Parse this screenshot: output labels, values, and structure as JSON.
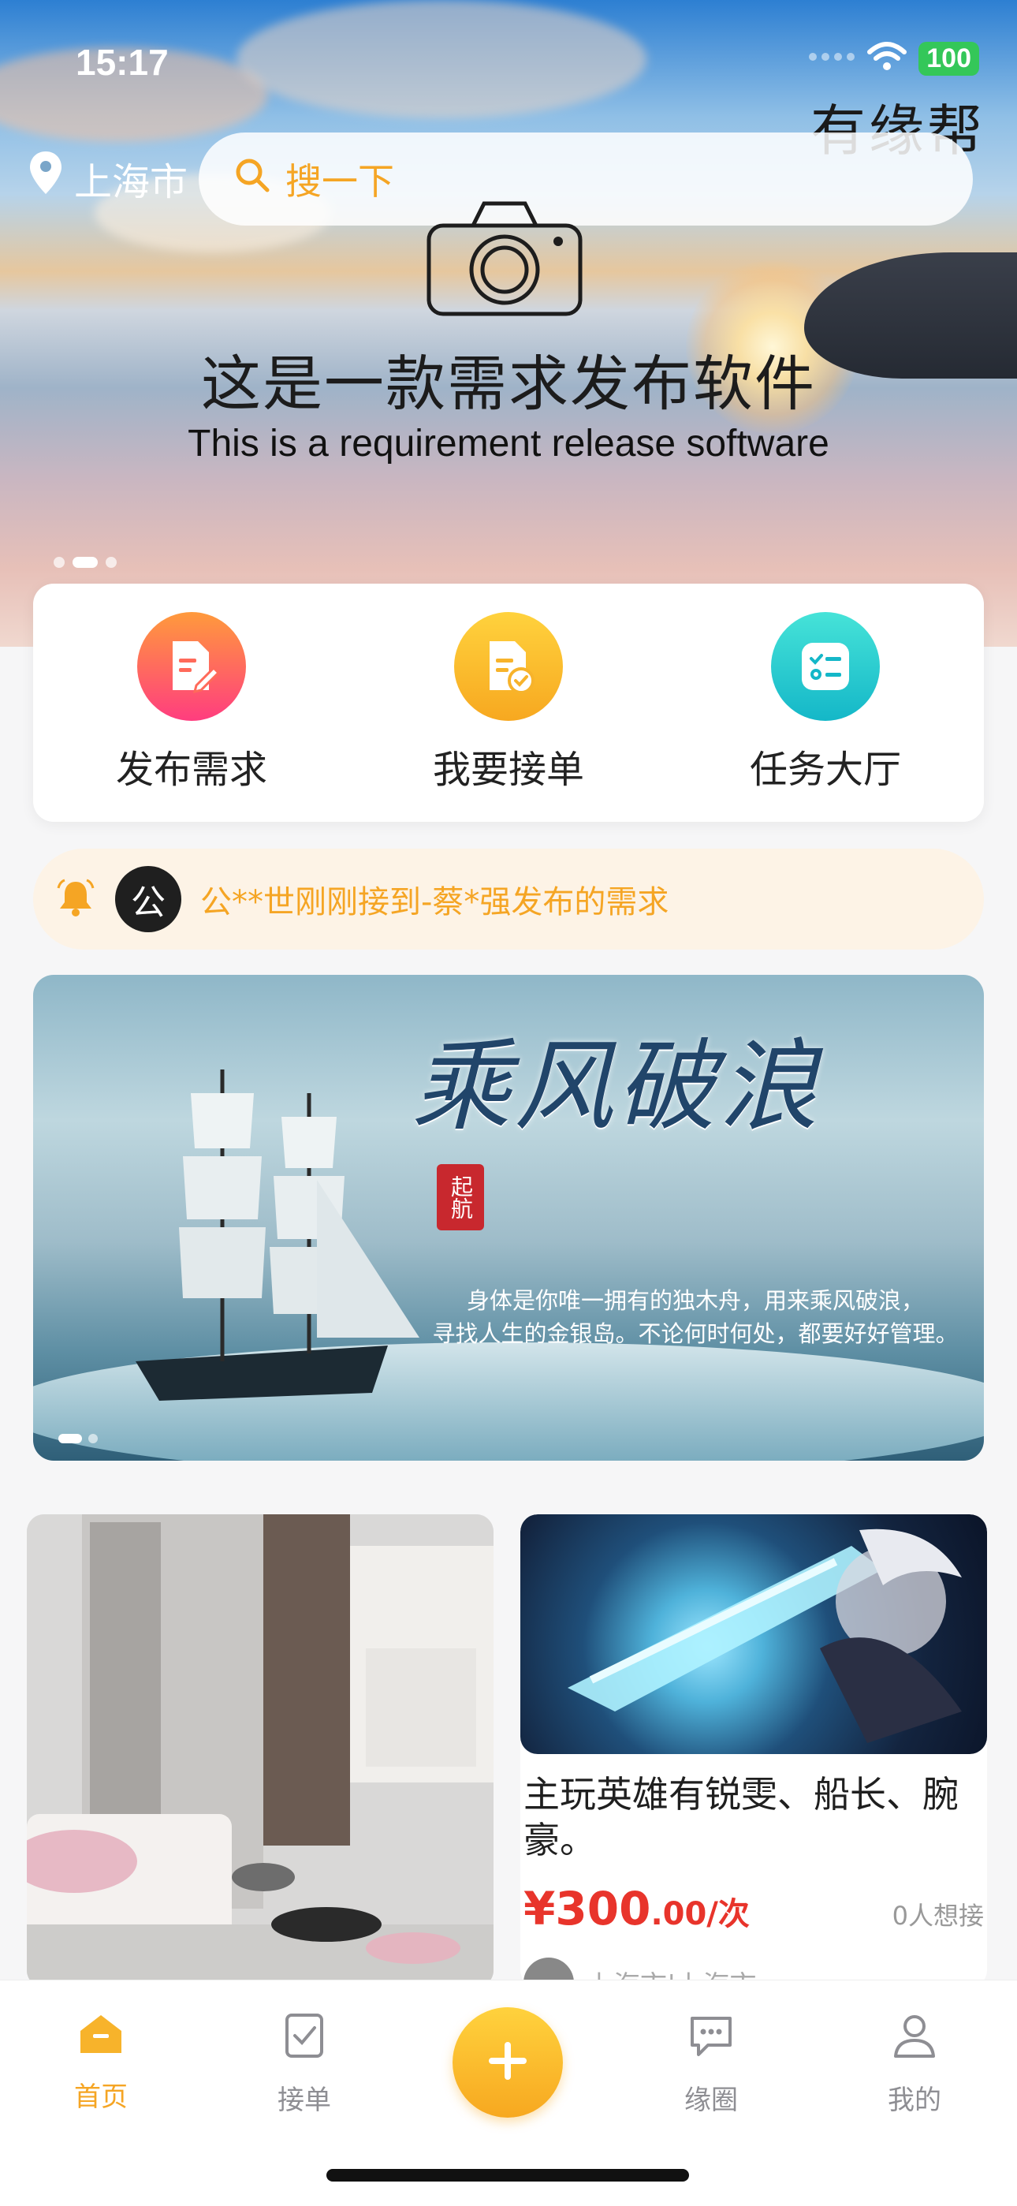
{
  "status": {
    "time": "15:17",
    "battery": "100"
  },
  "header": {
    "brand": "有缘帮",
    "location": "上海市",
    "search_placeholder": "搜一下"
  },
  "hero": {
    "title_cn": "这是一款需求发布软件",
    "title_en": "This is a requirement release software"
  },
  "actions": [
    {
      "label": "发布需求",
      "icon": "document-edit-icon",
      "color_from": "#ff9a3c",
      "color_to": "#ff3d7f"
    },
    {
      "label": "我要接单",
      "icon": "document-check-icon",
      "color_from": "#ffd23d",
      "color_to": "#f7a820"
    },
    {
      "label": "任务大厅",
      "icon": "checklist-icon",
      "color_from": "#46e3d8",
      "color_to": "#14b7c8"
    }
  ],
  "notice": {
    "avatar_text": "公",
    "text": "公**世刚刚接到-蔡*强发布的需求"
  },
  "banner2": {
    "title": "乘风破浪",
    "seal": "起航",
    "subtitle_line1": "身体是你唯一拥有的独木舟，用来乘风破浪，",
    "subtitle_line2": "寻找人生的金银岛。不论何时何处，都要好好管理。"
  },
  "cards": {
    "right": {
      "title": "主玩英雄有锐雯、船长、腕豪。",
      "price_main": "¥300",
      "price_tail": ".00/次",
      "want": "0人想接",
      "location": "上海市|上海市"
    }
  },
  "tabbar": {
    "home": "首页",
    "orders": "接单",
    "circle": "缘圈",
    "mine": "我的"
  },
  "colors": {
    "accent": "#f5a524",
    "price": "#e8342b"
  }
}
